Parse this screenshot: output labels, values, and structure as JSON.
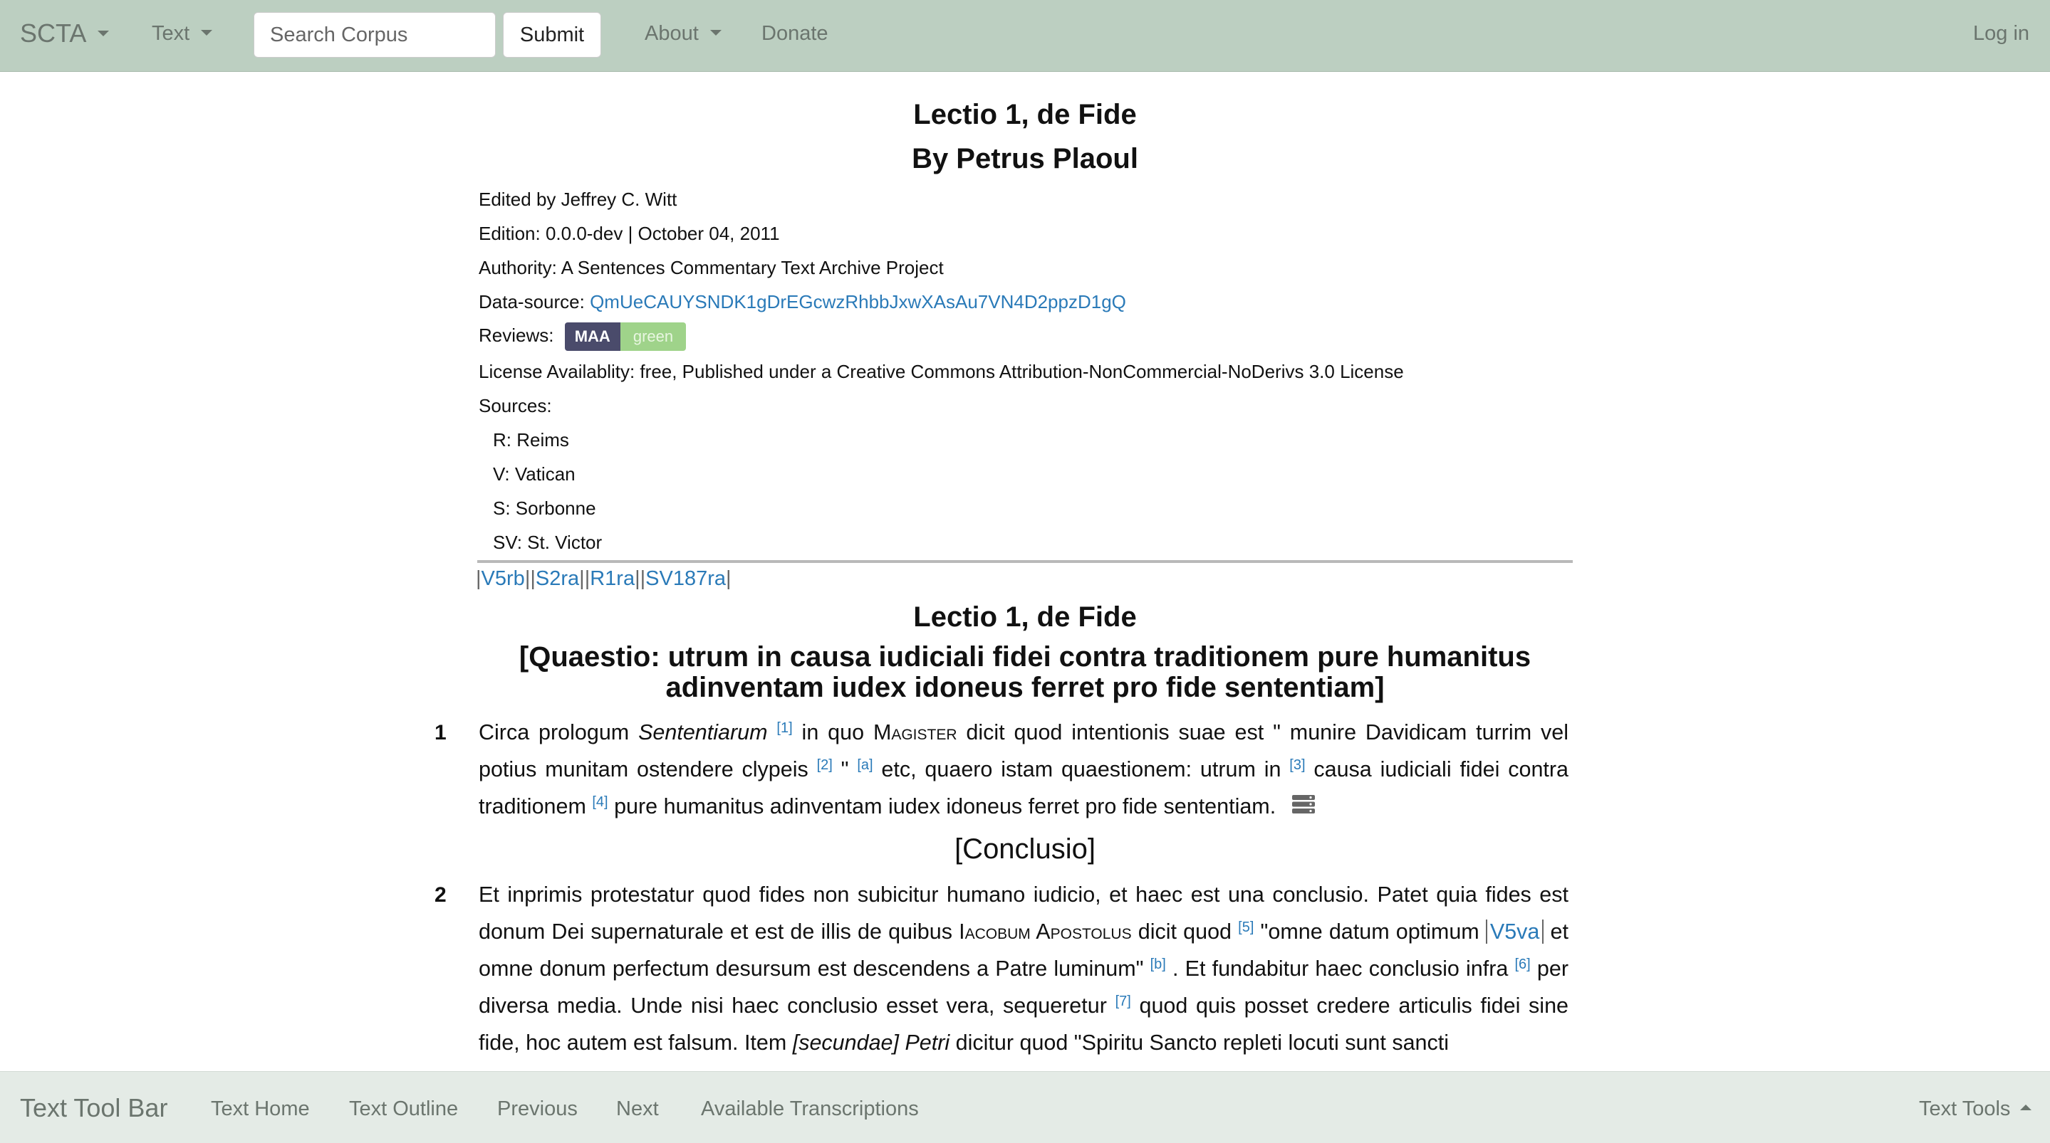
{
  "navbar": {
    "brand": "SCTA",
    "text_menu": "Text",
    "search_placeholder": "Search Corpus",
    "submit_label": "Submit",
    "about_menu": "About",
    "donate": "Donate",
    "login": "Log in"
  },
  "header": {
    "title": "Lectio 1, de Fide",
    "author_line": "By Petrus Plaoul",
    "edited_by": "Edited by Jeffrey C. Witt",
    "edition": "Edition: 0.0.0-dev | October 04, 2011",
    "authority": "Authority: A Sentences Commentary Text Archive Project",
    "data_source_label": "Data-source: ",
    "data_source_value": "QmUeCAUYSNDK1gDrEGcwzRhbbJxwXAsAu7VN4D2ppzD1gQ",
    "reviews_label": "Reviews:",
    "review_badge_left": "MAA",
    "review_badge_right": "green",
    "license": "License Availablity: free, Published under a Creative Commons Attribution-NonCommercial-NoDerivs 3.0 License",
    "sources_label": "Sources:",
    "sources": [
      "R: Reims",
      "V: Vatican",
      "S: Sorbonne",
      "SV: St. Victor"
    ]
  },
  "folios": [
    "V5rb",
    "S2ra",
    "R1ra",
    "SV187ra"
  ],
  "text": {
    "title": "Lectio 1, de Fide",
    "quaestio_line1": "[Quaestio: utrum in causa iudiciali fidei contra traditionem pure humanitus",
    "quaestio_line2": "adinventam iudex idoneus ferret pro fide sententiam]",
    "conclusio": "[Conclusio]",
    "p1_num": "1",
    "p1": {
      "a": "Circa prologum ",
      "b": "Sententiarum",
      "n1": "[1]",
      "c": " in quo ",
      "d": "Magister",
      "e": " dicit quod intentionis suae est \" munire Davidicam turrim vel potius munitam ostendere clypeis ",
      "n2": "[2]",
      "f": " \" ",
      "na": "[a]",
      "g": " etc, quaero istam quaestionem: utrum in ",
      "n3": "[3]",
      "h": " causa iudiciali fidei contra traditionem ",
      "n4": "[4]",
      "i": " pure humanitus adinventam iudex idoneus ferret pro fide sententiam."
    },
    "p2_num": "2",
    "p2": {
      "a": "Et inprimis protestatur quod fides non subicitur humano iudicio, et haec est una conclusio. Patet quia fides est donum Dei supernaturale et est de illis de quibus ",
      "b": "Iacobum Apostolus",
      "c": " dicit quod ",
      "n5": "[5]",
      "d": " \"omne datum optimum ",
      "fol": "V5va",
      "e": " et omne donum perfectum desursum est descendens a Patre luminum\" ",
      "nb": "[b]",
      "f": " . Et fundabitur haec conclusio infra ",
      "n6": "[6]",
      "g": " per diversa media. Unde nisi haec conclusio esset vera, sequeretur ",
      "n7": "[7]",
      "h": " quod quis posset credere articulis fidei sine fide, hoc autem est falsum. Item ",
      "i": "[secundae] Petri",
      "j": " dicitur quod \"Spiritu Sancto repleti locuti sunt sancti"
    }
  },
  "bottombar": {
    "brand": "Text Tool Bar",
    "links": [
      "Text Home",
      "Text Outline",
      "Previous",
      "Next",
      "Available Transcriptions"
    ],
    "tools": "Text Tools"
  },
  "colors": {
    "navbar_bg": "#bccfc1",
    "bottombar_bg": "#e4ebe6",
    "link": "#2a7ab8",
    "badge_dark": "#4a4b6b",
    "badge_green": "#9fd38a"
  }
}
